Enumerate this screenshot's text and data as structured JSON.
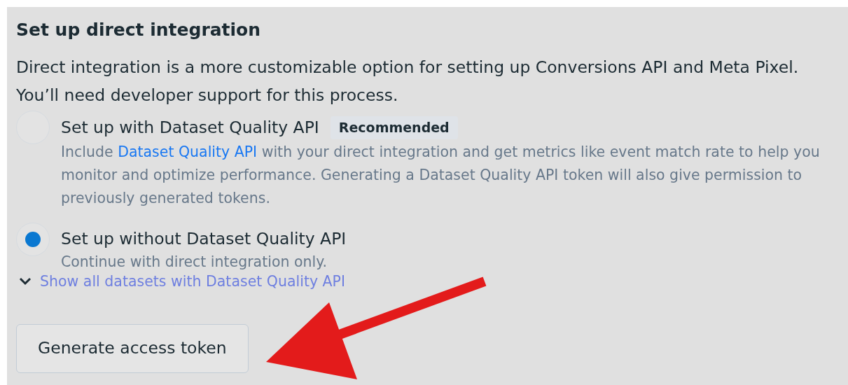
{
  "section": {
    "title": "Set up direct integration",
    "description": "Direct integration is a more customizable option for setting up Conversions API and Meta Pixel. You’ll need developer support for this process."
  },
  "options": [
    {
      "label": "Set up with Dataset Quality API",
      "badge": "Recommended",
      "selected": false,
      "description_before": "Include ",
      "link": "Dataset Quality API",
      "description_after": " with your direct integration and get metrics like event match rate to help you monitor and optimize performance. Generating a Dataset Quality API token will also give permission to previously generated tokens."
    },
    {
      "label": "Set up without Dataset Quality API",
      "selected": true,
      "description_before": "Continue with direct integration only."
    }
  ],
  "expander": {
    "label": "Show all datasets with Dataset Quality API",
    "expanded": false
  },
  "button": {
    "label": "Generate access token"
  }
}
